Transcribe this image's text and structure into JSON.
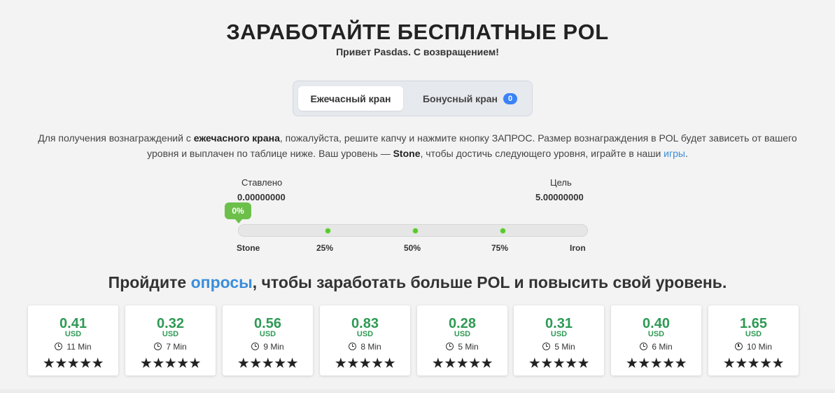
{
  "header": {
    "title": "ЗАРАБОТАЙТЕ БЕСПЛАТНЫЕ POL",
    "subtitle": "Привет Pasdas. С возвращением!"
  },
  "tabs": {
    "hourly_label": "Ежечасный кран",
    "bonus_label": "Бонусный кран",
    "bonus_count": "0"
  },
  "description": {
    "part1": "Для получения вознаграждений с ",
    "bold1": "ежечасного крана",
    "part2": ", пожалуйста, решите капчу и нажмите кнопку ЗАПРОС. Размер вознаграждения в POL будет зависеть от вашего уровня и выплачен по таблице ниже. Ваш уровень — ",
    "bold2": "Stone",
    "part3": ", чтобы достичь следующего уровня, играйте в наши ",
    "link": "игры",
    "part4": "."
  },
  "progress": {
    "staked_label": "Ставлено",
    "staked_value": "0.00000000",
    "goal_label": "Цель",
    "goal_value": "5.00000000",
    "percent_text": "0%",
    "percent": 0,
    "ticks": [
      "Stone",
      "25%",
      "50%",
      "75%",
      "Iron"
    ]
  },
  "surveys": {
    "headline_pre": "Пройдите ",
    "headline_link": "опросы",
    "headline_post": ", чтобы заработать больше POL и повысить свой уровень.",
    "cards": [
      {
        "amount": "0.41",
        "currency": "USD",
        "time": "11 Min",
        "stars": "★★★★★",
        "rating": 5
      },
      {
        "amount": "0.32",
        "currency": "USD",
        "time": "7 Min",
        "stars": "★★★★★",
        "rating": 5
      },
      {
        "amount": "0.56",
        "currency": "USD",
        "time": "9 Min",
        "stars": "★★★★★",
        "rating": 5
      },
      {
        "amount": "0.83",
        "currency": "USD",
        "time": "8 Min",
        "stars": "★★★★★",
        "rating": 5
      },
      {
        "amount": "0.28",
        "currency": "USD",
        "time": "5 Min",
        "stars": "★★★★★",
        "rating": 5
      },
      {
        "amount": "0.31",
        "currency": "USD",
        "time": "5 Min",
        "stars": "★★★★★",
        "rating": 5
      },
      {
        "amount": "0.40",
        "currency": "USD",
        "time": "6 Min",
        "stars": "★★★★★",
        "rating": 5
      },
      {
        "amount": "1.65",
        "currency": "USD",
        "time": "10 Min",
        "stars": "★★★★★",
        "rating": 5
      }
    ]
  },
  "colors": {
    "accent_green": "#2e9a54",
    "progress_green": "#6cc04a",
    "link_blue": "#3a8edb",
    "badge_blue": "#3b82f6"
  },
  "icons": {
    "clock": "clock-icon",
    "star": "star-icon"
  }
}
